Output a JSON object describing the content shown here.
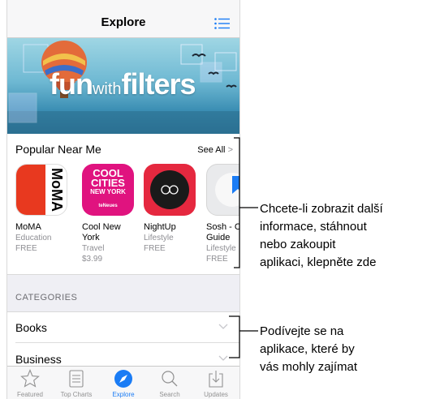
{
  "navbar": {
    "title": "Explore"
  },
  "banner": {
    "text_fun": "fun",
    "text_with": "with",
    "text_filters": "filters"
  },
  "popular": {
    "heading": "Popular Near Me",
    "see_all": "See All",
    "apps": [
      {
        "name": "MoMA",
        "category": "Education",
        "price": "FREE",
        "icon_text": "MoMA",
        "color": "#e8391f"
      },
      {
        "name": "Cool New York",
        "category": "Travel",
        "price": "$3.99",
        "icon_line1": "COOL",
        "icon_line2": "CITIES",
        "icon_line3": "NEW YORK",
        "icon_brand": "teNeues",
        "color": "#e0137f"
      },
      {
        "name": "NightUp",
        "category": "Lifestyle",
        "price": "FREE",
        "color": "#e5283f"
      },
      {
        "name": "Sosh - C Guide",
        "category": "Lifestyle",
        "price": "FREE",
        "color": "#1a7cf5"
      }
    ]
  },
  "categories": {
    "label": "CATEGORIES",
    "items": [
      {
        "label": "Books"
      },
      {
        "label": "Business"
      }
    ]
  },
  "tabbar": {
    "tabs": [
      {
        "label": "Featured",
        "icon": "star-icon"
      },
      {
        "label": "Top Charts",
        "icon": "list-icon"
      },
      {
        "label": "Explore",
        "icon": "compass-icon",
        "active": true
      },
      {
        "label": "Search",
        "icon": "search-icon"
      },
      {
        "label": "Updates",
        "icon": "download-icon"
      }
    ]
  },
  "callouts": {
    "first": [
      "Chcete-li zobrazit další",
      "informace, stáhnout",
      "nebo zakoupit",
      "aplikaci, klepněte zde"
    ],
    "second": [
      "Podívejte se na",
      "aplikace, které by",
      "vás mohly zajímat"
    ]
  },
  "colors": {
    "accent": "#1a7cf5",
    "nav_bg": "#f7f7f8",
    "section_bg": "#efeff4"
  }
}
